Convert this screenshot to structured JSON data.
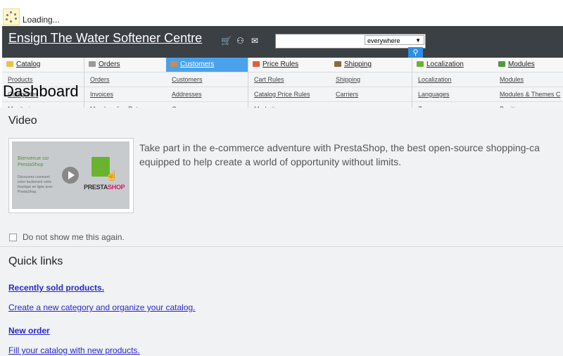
{
  "loading": {
    "text": "Loading..."
  },
  "header": {
    "shop_name": "Ensign The Water Softener Centre",
    "icons": [
      "cart-icon",
      "users-icon",
      "chat-icon"
    ],
    "search": {
      "value": "",
      "scope": "everywhere"
    }
  },
  "menu": [
    {
      "label": "Catalog",
      "icon": "folder-icon",
      "color": "#e8c24a",
      "active": false,
      "items": [
        "Products",
        "Categories",
        "Monitoring"
      ]
    },
    {
      "label": "Orders",
      "icon": "cart-icon",
      "color": "#9a9a9a",
      "active": false,
      "items": [
        "Orders",
        "Invoices",
        "Merchandise Returns"
      ]
    },
    {
      "label": "Customers",
      "icon": "customer-icon",
      "color": "#c98a5a",
      "active": true,
      "items": [
        "Customers",
        "Addresses",
        "Groups"
      ]
    },
    {
      "label": "Price Rules",
      "icon": "price-tag-icon",
      "color": "#e0603a",
      "active": false,
      "items": [
        "Cart Rules",
        "Catalog Price Rules",
        "Marketing"
      ]
    },
    {
      "label": "Shipping",
      "icon": "truck-icon",
      "color": "#8a6a3a",
      "active": false,
      "items": [
        "Shipping",
        "Carriers",
        ""
      ]
    },
    {
      "label": "Localization",
      "icon": "globe-icon",
      "color": "#6ab32f",
      "active": false,
      "items": [
        "Localization",
        "Languages",
        "Zones"
      ]
    },
    {
      "label": "Modules",
      "icon": "puzzle-icon",
      "color": "#4f9a3a",
      "active": false,
      "items": [
        "Modules",
        "Modules & Themes C",
        "Positions"
      ]
    }
  ],
  "page": {
    "title": "Dashboard"
  },
  "video": {
    "heading": "Video",
    "thumb_text": "Bienvenue sur PrestaShop",
    "thumb_small": "Découvrez comment créer facilement votre boutique en ligne avec PrestaShop.",
    "brand_a": "PRESTA",
    "brand_b": "SHOP",
    "description_line1": "Take part in the e-commerce adventure with PrestaShop, the best open-source shopping-ca",
    "description_line2": "equipped to help create a world of opportunity without limits.",
    "checkbox_label": "Do not show me this again."
  },
  "quick_links": {
    "heading": "Quick links",
    "links": [
      {
        "label": "Recently sold products.",
        "bold": true
      },
      {
        "label": "Create a new category and organize your catalog.",
        "bold": false
      },
      {
        "label": "New order",
        "bold": true
      },
      {
        "label": "Fill your catalog with new products.",
        "bold": false
      }
    ]
  }
}
